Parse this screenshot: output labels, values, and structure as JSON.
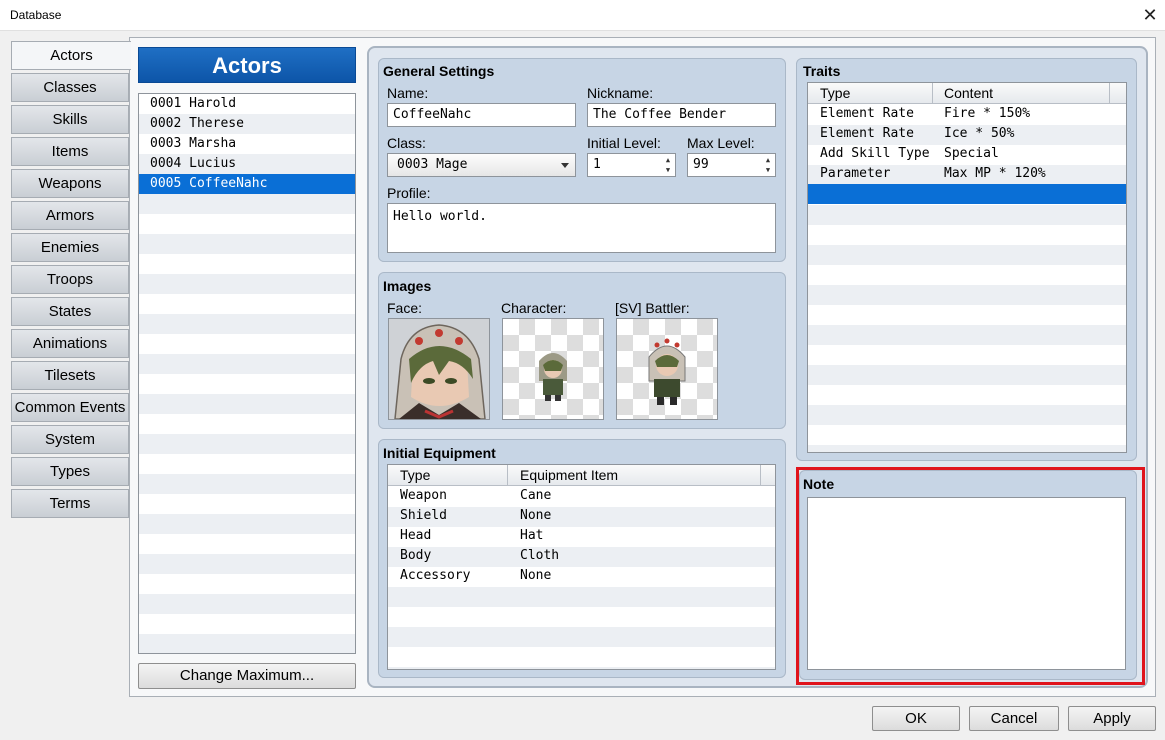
{
  "window": {
    "title": "Database",
    "close_glyph": "✕"
  },
  "tabs": [
    "Actors",
    "Classes",
    "Skills",
    "Items",
    "Weapons",
    "Armors",
    "Enemies",
    "Troops",
    "States",
    "Animations",
    "Tilesets",
    "Common Events",
    "System",
    "Types",
    "Terms"
  ],
  "active_tab": "Actors",
  "actor_list": {
    "header": "Actors",
    "items": [
      "0001 Harold",
      "0002 Therese",
      "0003 Marsha",
      "0004 Lucius",
      "0005 CoffeeNahc"
    ],
    "selected_index": 4,
    "change_max_label": "Change Maximum..."
  },
  "general": {
    "title": "General Settings",
    "name_label": "Name:",
    "name_value": "CoffeeNahc",
    "nickname_label": "Nickname:",
    "nickname_value": "The Coffee Bender",
    "class_label": "Class:",
    "class_value": "0003 Mage",
    "initial_level_label": "Initial Level:",
    "initial_level_value": "1",
    "max_level_label": "Max Level:",
    "max_level_value": "99",
    "profile_label": "Profile:",
    "profile_value": "Hello world."
  },
  "images": {
    "title": "Images",
    "face_label": "Face:",
    "character_label": "Character:",
    "battler_label": "[SV] Battler:"
  },
  "equipment": {
    "title": "Initial Equipment",
    "columns": [
      "Type",
      "Equipment Item"
    ],
    "rows": [
      {
        "type": "Weapon",
        "item": "Cane"
      },
      {
        "type": "Shield",
        "item": "None"
      },
      {
        "type": "Head",
        "item": "Hat"
      },
      {
        "type": "Body",
        "item": "Cloth"
      },
      {
        "type": "Accessory",
        "item": "None"
      }
    ]
  },
  "traits": {
    "title": "Traits",
    "columns": [
      "Type",
      "Content"
    ],
    "rows": [
      {
        "type": "Element Rate",
        "content": "Fire * 150%"
      },
      {
        "type": "Element Rate",
        "content": "Ice * 50%"
      },
      {
        "type": "Add Skill Type",
        "content": "Special"
      },
      {
        "type": "Parameter",
        "content": "Max MP * 120%"
      }
    ]
  },
  "note": {
    "title": "Note",
    "value": ""
  },
  "buttons": {
    "ok": "OK",
    "cancel": "Cancel",
    "apply": "Apply"
  },
  "colors": {
    "selection": "#0a6fd6",
    "header_blue": "#1f6fc4",
    "highlight": "#e0141c"
  }
}
